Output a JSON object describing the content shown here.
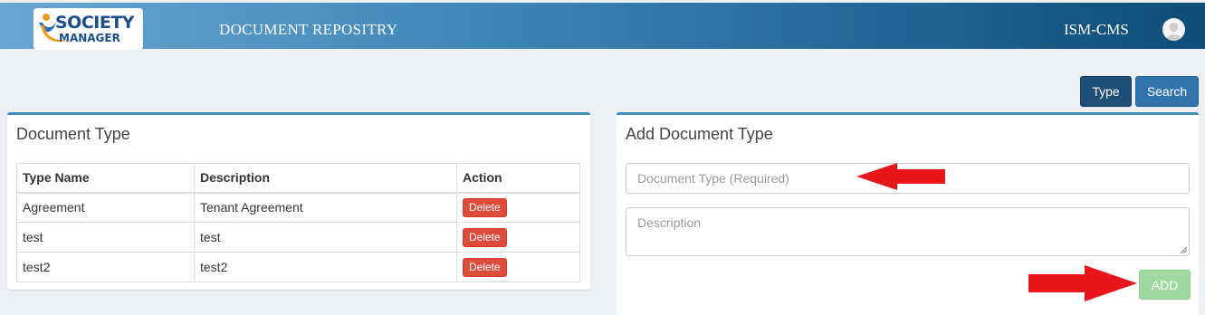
{
  "header": {
    "logo_line1": "SOCIETY",
    "logo_line2": "MANAGER",
    "title": "DOCUMENT REPOSITRY",
    "org": "ISM-CMS",
    "avatar_icon": "user-avatar-icon"
  },
  "toolbar": {
    "type_label": "Type",
    "search_label": "Search"
  },
  "doc_type_panel": {
    "title": "Document Type",
    "columns": [
      "Type Name",
      "Description",
      "Action"
    ],
    "rows": [
      {
        "name": "Agreement",
        "description": "Tenant Agreement",
        "action": "Delete"
      },
      {
        "name": "test",
        "description": "test",
        "action": "Delete"
      },
      {
        "name": "test2",
        "description": "test2",
        "action": "Delete"
      }
    ]
  },
  "add_panel": {
    "title": "Add Document Type",
    "type_placeholder": "Document Type (Required)",
    "description_placeholder": "Description",
    "add_label": "ADD"
  },
  "colors": {
    "accent": "#3c8dbc",
    "danger": "#dd4b39",
    "success_disabled": "#9fd9a0",
    "annotation_arrow": "#e8161b"
  }
}
